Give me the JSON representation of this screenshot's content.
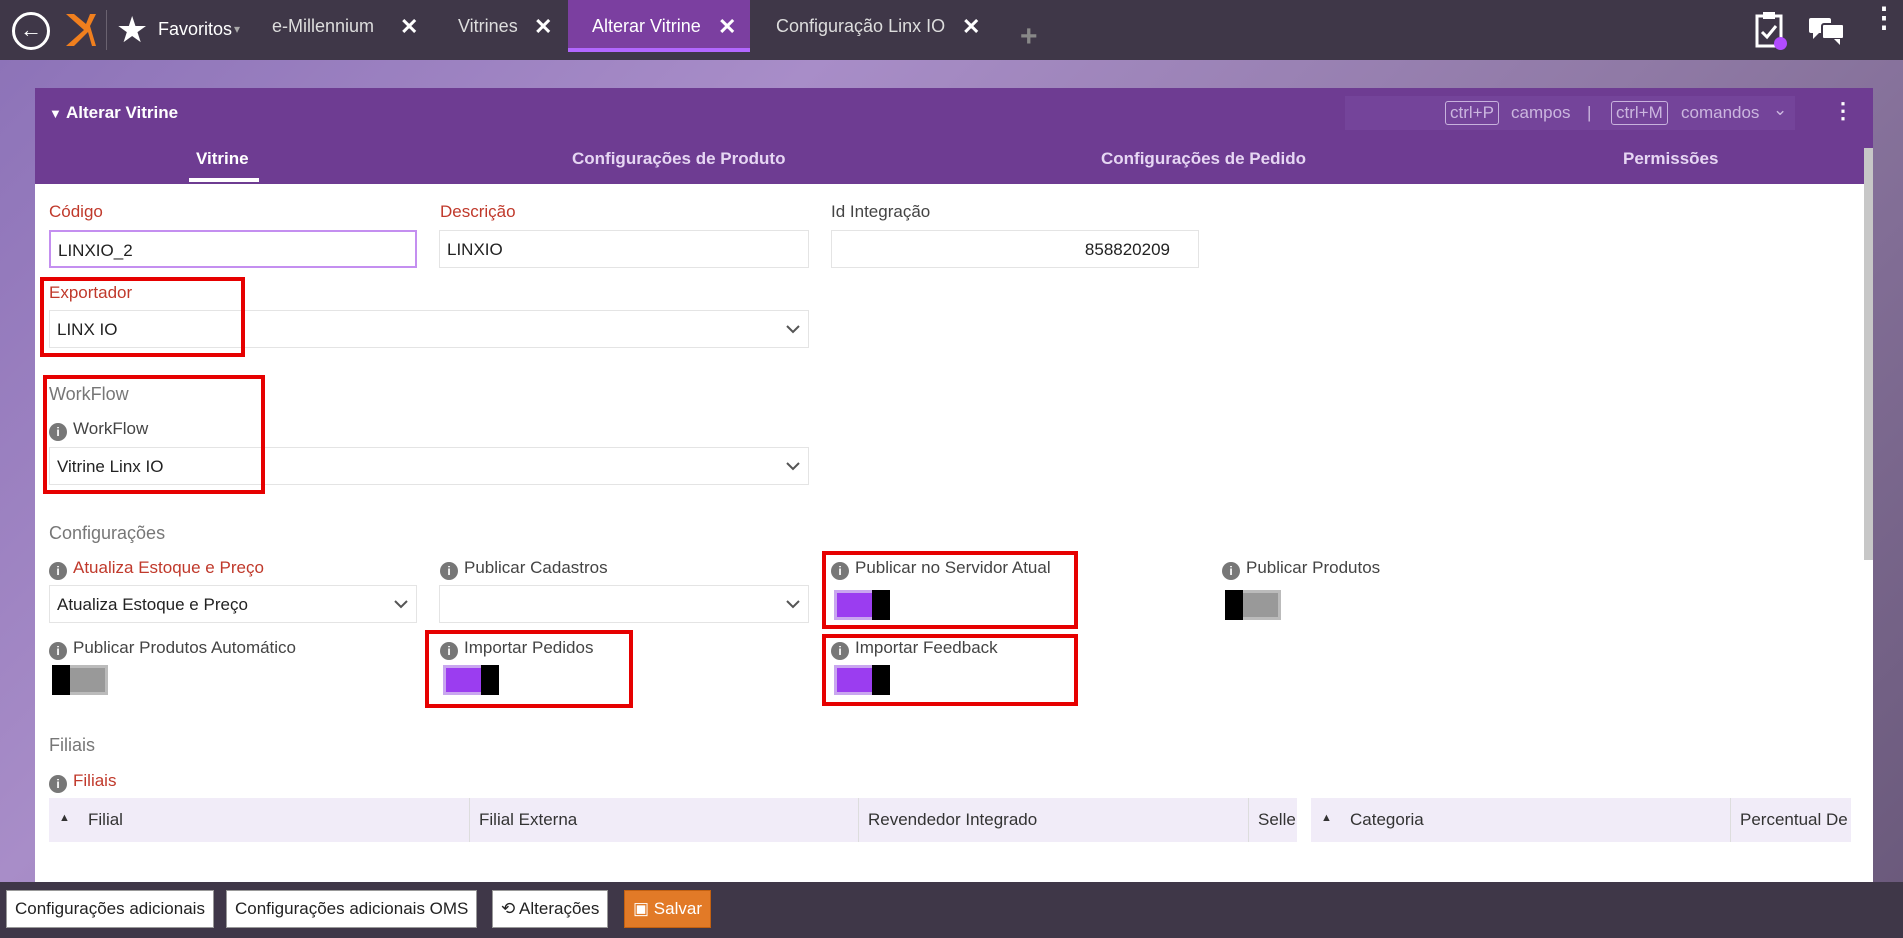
{
  "topbar": {
    "back_icon": "arrow-left-circle-icon",
    "favorites_label": "Favoritos",
    "tabs": [
      {
        "label": "e-Millennium"
      },
      {
        "label": "Vitrines"
      },
      {
        "label": "Alterar Vitrine",
        "active": true
      },
      {
        "label": "Configuração Linx IO"
      }
    ]
  },
  "panel": {
    "title": "Alterar Vitrine",
    "shortcut_fields_key": "ctrl+P",
    "shortcut_fields_label": "campos",
    "shortcut_separator": "|",
    "shortcut_commands_key": "ctrl+M",
    "shortcut_commands_label": "comandos",
    "tabs": [
      "Vitrine",
      "Configurações de Produto",
      "Configurações de Pedido",
      "Permissões"
    ]
  },
  "form": {
    "codigo_label": "Código",
    "codigo_value": "LINXIO_2",
    "descricao_label": "Descrição",
    "descricao_value": "LINXIO",
    "id_integracao_label": "Id Integração",
    "id_integracao_value": "858820209",
    "exportador_label": "Exportador",
    "exportador_value": "LINX IO",
    "workflow_section": "WorkFlow",
    "workflow_label": "WorkFlow",
    "workflow_value": "Vitrine Linx IO",
    "config_section": "Configurações",
    "atualiza_label": "Atualiza Estoque e Preço",
    "atualiza_value": "Atualiza Estoque e Preço",
    "publicar_cadastros_label": "Publicar Cadastros",
    "publicar_cadastros_value": "",
    "publicar_servidor_label": "Publicar no Servidor Atual",
    "publicar_servidor_on": true,
    "publicar_produtos_label": "Publicar Produtos",
    "publicar_produtos_on": false,
    "publicar_auto_label": "Publicar Produtos Automático",
    "publicar_auto_on": false,
    "importar_pedidos_label": "Importar Pedidos",
    "importar_pedidos_on": true,
    "importar_feedback_label": "Importar Feedback",
    "importar_feedback_on": true,
    "filiais_section": "Filiais",
    "filiais_label": "Filiais"
  },
  "grid_left": {
    "columns": [
      "Filial",
      "Filial Externa",
      "Revendedor Integrado",
      "Selle"
    ]
  },
  "grid_right": {
    "columns": [
      "Categoria",
      "Percentual De"
    ]
  },
  "bottom": {
    "btn_config_adicionais": "Configurações adicionais",
    "btn_config_oms": "Configurações adicionais OMS",
    "btn_alteracoes": "Alterações",
    "btn_salvar": "Salvar"
  },
  "colors": {
    "accent": "#6e3c92",
    "toggle_on": "#9b3df0",
    "highlight": "#e60000",
    "save": "#e27a27"
  }
}
